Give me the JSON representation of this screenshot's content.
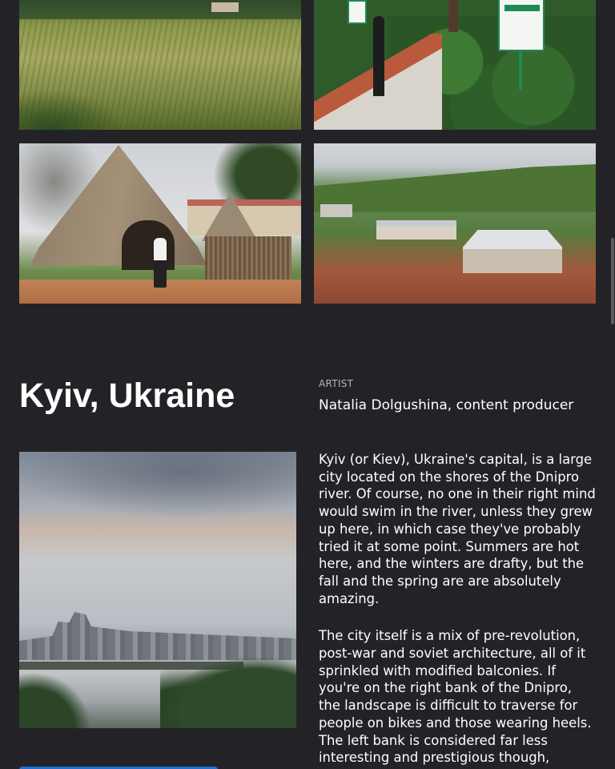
{
  "gallery": {
    "images": [
      {
        "subject": "tall-grass-field"
      },
      {
        "subject": "hedges-with-parking-sign"
      },
      {
        "subject": "thatched-hut"
      },
      {
        "subject": "hillside-houses"
      }
    ]
  },
  "section": {
    "title": "Kyiv, Ukraine",
    "artist_label": "ARTIST",
    "artist_name": "Natalia Dolgushina, content producer",
    "photo_subject": "kyiv-river-cityscape",
    "paragraphs": [
      "Kyiv (or Kiev), Ukraine's capital, is a large city located on the shores of the Dnipro river. Of course, no one in their right mind would swim in the river, unless they grew up here, in which case they've probably tried it at some point. Summers are hot here, and the winters are drafty, but the fall and the spring are are absolutely amazing.",
      "The city itself is a mix of pre-revolution, post-war and soviet architecture, all of it sprinkled with modified balconies. If you're on the right bank of the Dnipro, the landscape is difficult to traverse for people on bikes and those wearing heels. The left bank is considered far less interesting and prestigious though,"
    ]
  },
  "colors": {
    "background": "#232327",
    "text": "#ffffff",
    "muted": "#b5b6ba",
    "accent": "#1f73d8",
    "scrollbar": "#5c5d62"
  }
}
